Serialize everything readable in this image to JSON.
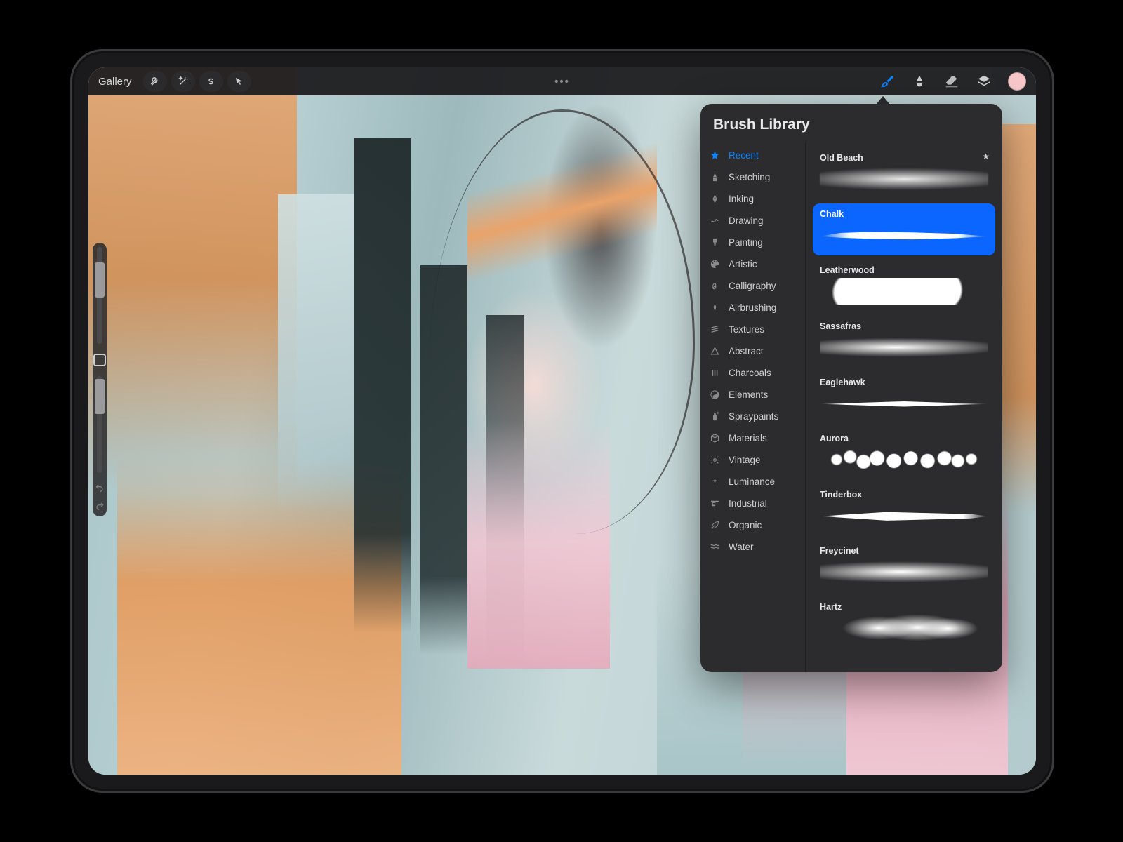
{
  "topbar": {
    "gallery_label": "Gallery",
    "color_swatch": "#f6c6c9"
  },
  "popover": {
    "title": "Brush Library"
  },
  "categories": [
    {
      "label": "Recent",
      "icon": "star",
      "active": true
    },
    {
      "label": "Sketching",
      "icon": "pencil-tip",
      "active": false
    },
    {
      "label": "Inking",
      "icon": "nib",
      "active": false
    },
    {
      "label": "Drawing",
      "icon": "squiggle",
      "active": false
    },
    {
      "label": "Painting",
      "icon": "paintbrush",
      "active": false
    },
    {
      "label": "Artistic",
      "icon": "palette",
      "active": false
    },
    {
      "label": "Calligraphy",
      "icon": "script-a",
      "active": false
    },
    {
      "label": "Airbrushing",
      "icon": "airbrush",
      "active": false
    },
    {
      "label": "Textures",
      "icon": "hatch",
      "active": false
    },
    {
      "label": "Abstract",
      "icon": "triangle",
      "active": false
    },
    {
      "label": "Charcoals",
      "icon": "bars",
      "active": false
    },
    {
      "label": "Elements",
      "icon": "yinyang",
      "active": false
    },
    {
      "label": "Spraypaints",
      "icon": "spraycan",
      "active": false
    },
    {
      "label": "Materials",
      "icon": "cube",
      "active": false
    },
    {
      "label": "Vintage",
      "icon": "gear",
      "active": false
    },
    {
      "label": "Luminance",
      "icon": "sparkle",
      "active": false
    },
    {
      "label": "Industrial",
      "icon": "anvil",
      "active": false
    },
    {
      "label": "Organic",
      "icon": "leaf",
      "active": false
    },
    {
      "label": "Water",
      "icon": "waves",
      "active": false
    }
  ],
  "brushes": [
    {
      "name": "Old Beach",
      "style": "bs-smear",
      "favorite": true,
      "selected": false
    },
    {
      "name": "Chalk",
      "style": "bs-chalk",
      "favorite": false,
      "selected": true
    },
    {
      "name": "Leatherwood",
      "style": "bs-cloud",
      "favorite": false,
      "selected": false
    },
    {
      "name": "Sassafras",
      "style": "bs-soft",
      "favorite": false,
      "selected": false
    },
    {
      "name": "Eaglehawk",
      "style": "bs-needle",
      "favorite": false,
      "selected": false
    },
    {
      "name": "Aurora",
      "style": "bs-spray",
      "favorite": false,
      "selected": false
    },
    {
      "name": "Tinderbox",
      "style": "bs-taper",
      "favorite": false,
      "selected": false
    },
    {
      "name": "Freycinet",
      "style": "bs-rough",
      "favorite": false,
      "selected": false
    },
    {
      "name": "Hartz",
      "style": "bs-blotch",
      "favorite": false,
      "selected": false
    }
  ]
}
